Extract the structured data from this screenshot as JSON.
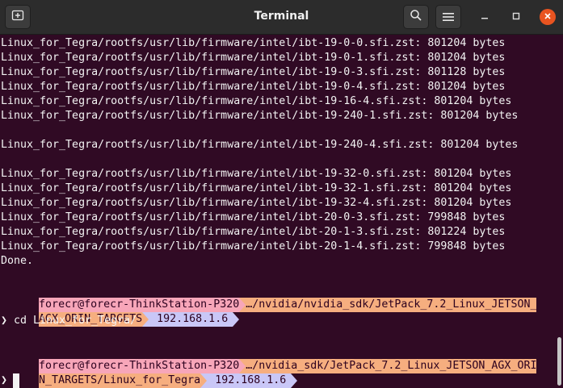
{
  "header": {
    "title": "Terminal",
    "new_tab_icon": "new-tab-icon",
    "search_icon": "search-icon",
    "menu_icon": "hamburger-menu-icon",
    "minimize_icon": "minimize-icon",
    "maximize_icon": "maximize-icon",
    "close_icon": "close-icon"
  },
  "colors": {
    "terminal_bg": "#300a24",
    "user_segment": "#f7a6b9",
    "path_segment": "#f6ae7f",
    "ip_segment": "#c9c7f7",
    "close_button": "#e95420"
  },
  "terminal": {
    "output_lines": [
      "Linux_for_Tegra/rootfs/usr/lib/firmware/intel/ibt-19-0-0.sfi.zst: 801204 bytes",
      "Linux_for_Tegra/rootfs/usr/lib/firmware/intel/ibt-19-0-1.sfi.zst: 801204 bytes",
      "Linux_for_Tegra/rootfs/usr/lib/firmware/intel/ibt-19-0-3.sfi.zst: 801128 bytes",
      "Linux_for_Tegra/rootfs/usr/lib/firmware/intel/ibt-19-0-4.sfi.zst: 801204 bytes",
      "Linux_for_Tegra/rootfs/usr/lib/firmware/intel/ibt-19-16-4.sfi.zst: 801204 bytes",
      "Linux_for_Tegra/rootfs/usr/lib/firmware/intel/ibt-19-240-1.sfi.zst: 801204 bytes",
      "",
      "Linux_for_Tegra/rootfs/usr/lib/firmware/intel/ibt-19-240-4.sfi.zst: 801204 bytes",
      "",
      "Linux_for_Tegra/rootfs/usr/lib/firmware/intel/ibt-19-32-0.sfi.zst: 801204 bytes",
      "Linux_for_Tegra/rootfs/usr/lib/firmware/intel/ibt-19-32-1.sfi.zst: 801204 bytes",
      "Linux_for_Tegra/rootfs/usr/lib/firmware/intel/ibt-19-32-4.sfi.zst: 801204 bytes",
      "Linux_for_Tegra/rootfs/usr/lib/firmware/intel/ibt-20-0-3.sfi.zst: 799848 bytes",
      "Linux_for_Tegra/rootfs/usr/lib/firmware/intel/ibt-20-1-3.sfi.zst: 801224 bytes",
      "Linux_for_Tegra/rootfs/usr/lib/firmware/intel/ibt-20-1-4.sfi.zst: 799848 bytes",
      "Done."
    ],
    "prompt1": {
      "user": "forecr@forecr-ThinkStation-P320",
      "path_line1": "…/nvidia/nvidia_sdk/JetPack_7.2_Linux_JETSON_",
      "path_line2": "AGX_ORIN_TARGETS",
      "ip": "192.168.1.6",
      "command": "❯ cd Linux_for_Tegra/"
    },
    "prompt2": {
      "user": "forecr@forecr-ThinkStation-P320",
      "path_line1": "…/nvidia_sdk/JetPack_7.2_Linux_JETSON_AGX_ORI",
      "path_line2": "N_TARGETS/Linux_for_Tegra",
      "ip": "192.168.1.6",
      "input": "❯"
    }
  }
}
